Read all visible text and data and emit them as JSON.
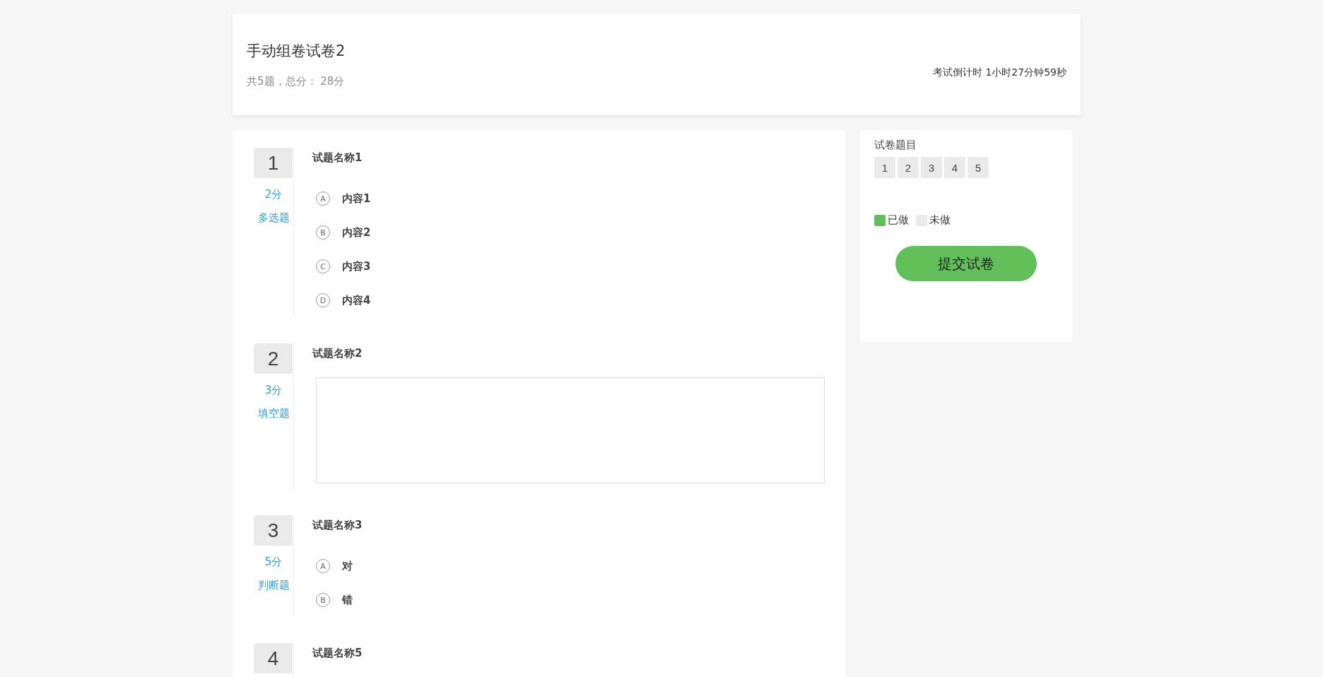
{
  "header": {
    "title": "手动组卷试卷2",
    "summary": "共5题，总分： 28分",
    "countdown": "考试倒计时 1小时27分钟59秒"
  },
  "questions": [
    {
      "number": "1",
      "score": "2分",
      "type_label": "多选题",
      "title": "试题名称1",
      "kind": "choice",
      "options": [
        {
          "letter": "A",
          "text": "内容1"
        },
        {
          "letter": "B",
          "text": "内容2"
        },
        {
          "letter": "C",
          "text": "内容3"
        },
        {
          "letter": "D",
          "text": "内容4"
        }
      ]
    },
    {
      "number": "2",
      "score": "3分",
      "type_label": "填空题",
      "title": "试题名称2",
      "kind": "text"
    },
    {
      "number": "3",
      "score": "5分",
      "type_label": "判断题",
      "title": "试题名称3",
      "kind": "choice",
      "options": [
        {
          "letter": "A",
          "text": "对"
        },
        {
          "letter": "B",
          "text": "错"
        }
      ]
    },
    {
      "number": "4",
      "title": "试题名称5",
      "kind": "choice"
    }
  ],
  "sidebar": {
    "title": "试卷题目",
    "question_buttons": [
      {
        "label": "1",
        "done": false
      },
      {
        "label": "2",
        "done": false
      },
      {
        "label": "3",
        "done": false
      },
      {
        "label": "4",
        "done": false
      },
      {
        "label": "5",
        "done": false
      }
    ],
    "legend": [
      {
        "label": "已做",
        "color": "#62c05a"
      },
      {
        "label": "未做",
        "color": "#eaeaea"
      }
    ],
    "submit": "提交试卷"
  }
}
